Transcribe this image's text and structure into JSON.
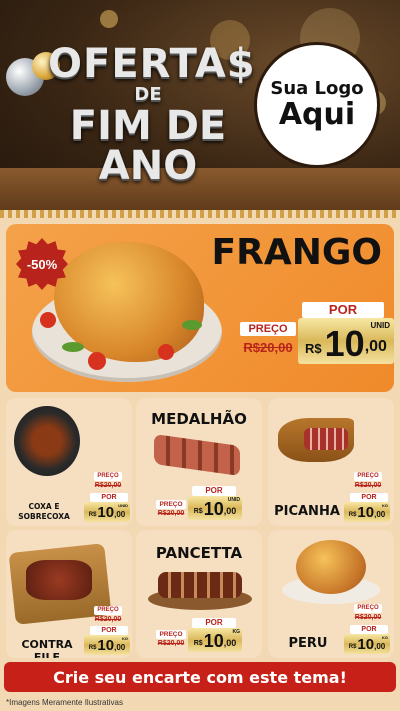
{
  "header": {
    "title_line1": "OFERTA$",
    "title_line2": "DE",
    "title_line3": "FIM DE ANO",
    "logo_line1": "Sua Logo",
    "logo_line2": "Aqui"
  },
  "featured": {
    "name": "FRANGO",
    "discount_badge": "-50%",
    "por_label": "POR",
    "preco_label": "PREÇO",
    "old_price": "R$20,00",
    "currency": "R$",
    "price_int": "10",
    "price_dec": ",00",
    "unit": "UNID"
  },
  "products": [
    {
      "name": "COXA E SOBRECOXA",
      "preco_label": "PREÇO",
      "old_price": "R$20,00",
      "por_label": "POR",
      "currency": "R$",
      "price_int": "10",
      "price_dec": ",00",
      "unit": "UNID"
    },
    {
      "name": "MEDALHÃO",
      "preco_label": "PREÇO",
      "old_price": "R$20,00",
      "por_label": "POR",
      "currency": "R$",
      "price_int": "10",
      "price_dec": ",00",
      "unit": "UNID"
    },
    {
      "name": "PICANHA",
      "preco_label": "PREÇO",
      "old_price": "R$20,00",
      "por_label": "POR",
      "currency": "R$",
      "price_int": "10",
      "price_dec": ",00",
      "unit": "KG"
    },
    {
      "name": "CONTRA FILE",
      "preco_label": "PREÇO",
      "old_price": "R$20,00",
      "por_label": "POR",
      "currency": "R$",
      "price_int": "10",
      "price_dec": ",00",
      "unit": "KG"
    },
    {
      "name": "PANCETTA",
      "preco_label": "PREÇO",
      "old_price": "R$20,00",
      "por_label": "POR",
      "currency": "R$",
      "price_int": "10",
      "price_dec": ",00",
      "unit": "KG"
    },
    {
      "name": "PERU",
      "preco_label": "PREÇO",
      "old_price": "R$20,00",
      "por_label": "POR",
      "currency": "R$",
      "price_int": "10",
      "price_dec": ",00",
      "unit": "KG"
    }
  ],
  "cta_label": "Crie seu encarte com este tema!",
  "footnote": "*Imagens Meramente Ilustrativas",
  "colors": {
    "accent_red": "#c62018",
    "orange": "#f08a2a",
    "gold": "#d9b85a"
  }
}
